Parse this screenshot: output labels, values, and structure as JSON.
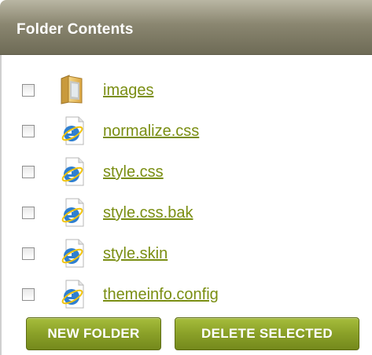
{
  "panel": {
    "title": "Folder Contents"
  },
  "files": [
    {
      "name": "images",
      "icon": "folder-icon",
      "checked": false
    },
    {
      "name": "normalize.css",
      "icon": "ie-file-icon",
      "checked": false
    },
    {
      "name": "style.css",
      "icon": "ie-file-icon",
      "checked": false
    },
    {
      "name": "style.css.bak",
      "icon": "ie-file-icon",
      "checked": false
    },
    {
      "name": "style.skin",
      "icon": "ie-file-icon",
      "checked": false
    },
    {
      "name": "themeinfo.config",
      "icon": "ie-file-icon",
      "checked": false
    }
  ],
  "actions": {
    "new_folder_label": "NEW FOLDER",
    "delete_selected_label": "DELETE SELECTED"
  },
  "colors": {
    "header_bg": "#8a8670",
    "link": "#7a8e12",
    "button_bg": "#8aa028",
    "button_text": "#ffffff"
  }
}
